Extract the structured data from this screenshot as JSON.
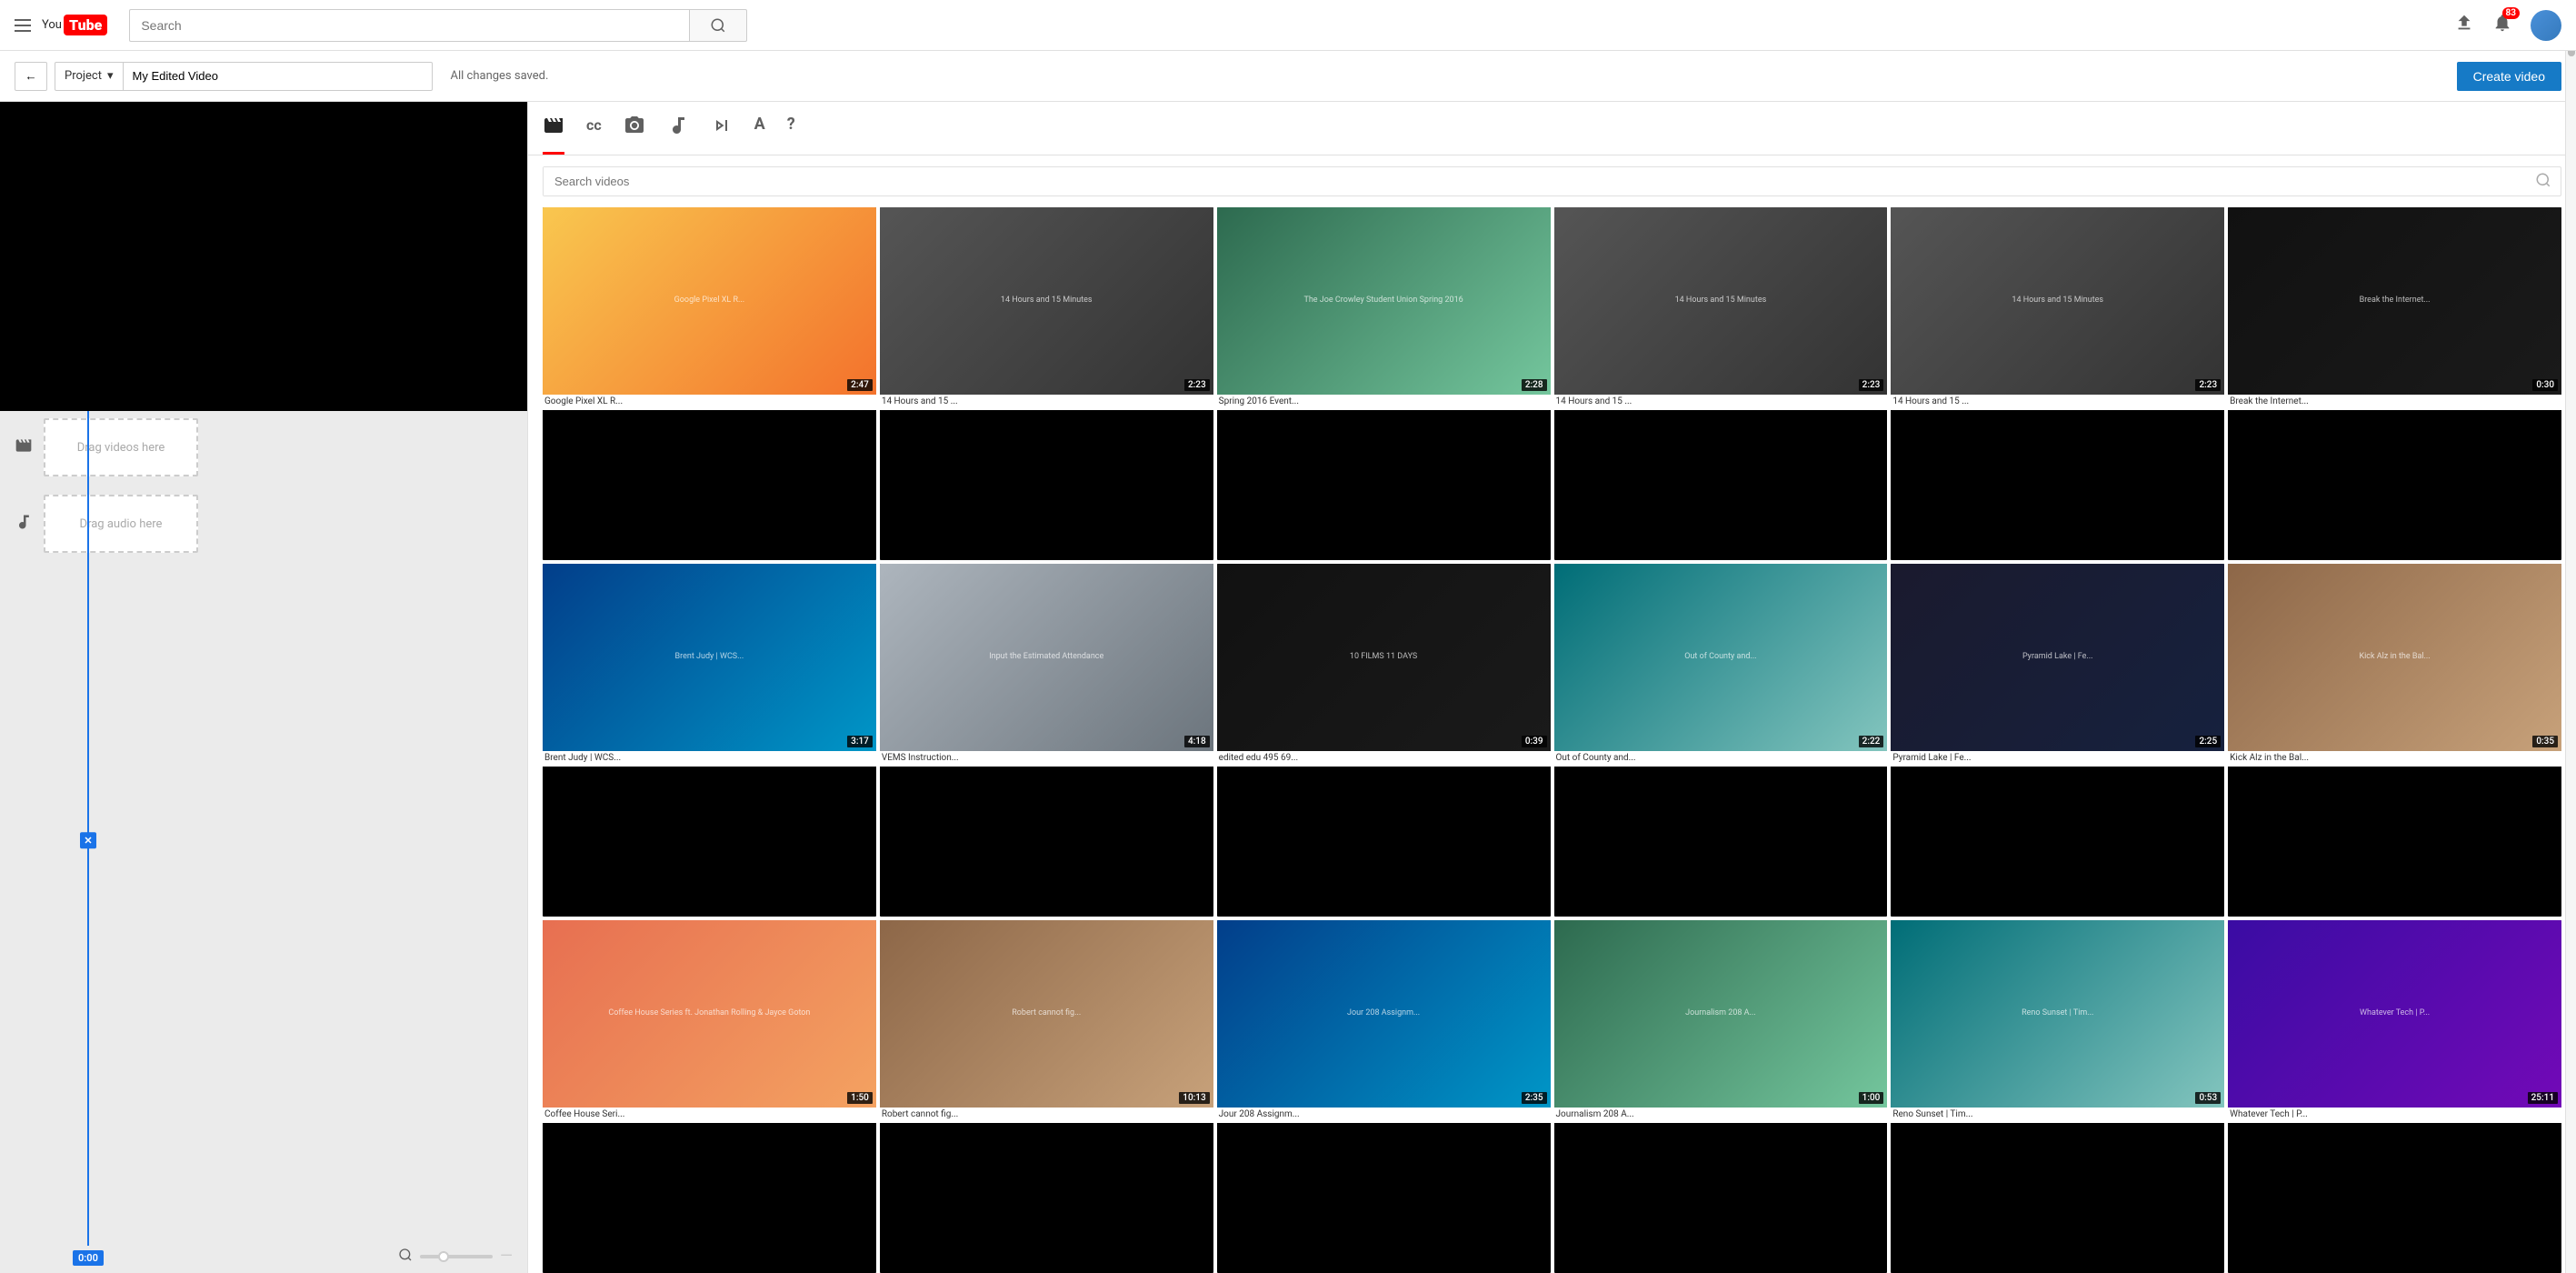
{
  "header": {
    "menu_label": "Menu",
    "logo_you": "You",
    "logo_tube": "Tube",
    "search_placeholder": "Search",
    "search_button_label": "Search",
    "upload_icon": "⬆",
    "notifications_icon": "🔔",
    "notification_count": "83",
    "avatar_label": "User avatar"
  },
  "toolbar": {
    "back_label": "←",
    "project_label": "Project",
    "project_dropdown_arrow": "▾",
    "project_name": "My Edited Video",
    "saved_status": "All changes saved.",
    "create_video_label": "Create video"
  },
  "panel": {
    "tabs": [
      {
        "id": "video",
        "icon": "🎥",
        "active": true
      },
      {
        "id": "cc",
        "icon": "©"
      },
      {
        "id": "photo",
        "icon": "📷"
      },
      {
        "id": "music",
        "icon": "♪"
      },
      {
        "id": "transitions",
        "icon": "⏭"
      },
      {
        "id": "text",
        "icon": "A"
      },
      {
        "id": "help",
        "icon": "?"
      }
    ],
    "search_placeholder": "Search videos",
    "videos": [
      {
        "title": "Google Pixel XL R...",
        "duration": "2:47",
        "color": "thumb-yellow"
      },
      {
        "title": "14 Hours and 15 ...",
        "duration": "2:23",
        "color": "thumb-gray",
        "label": "14 Hours and 15 Minutes"
      },
      {
        "title": "Spring 2016 Event...",
        "duration": "2:28",
        "color": "thumb-green",
        "label": "The Joe Crowley Student Union Spring 2016"
      },
      {
        "title": "14 Hours and 15 ...",
        "duration": "2:23",
        "color": "thumb-gray",
        "label": "14 Hours and 15 Minutes"
      },
      {
        "title": "14 Hours and 15 ...",
        "duration": "2:23",
        "color": "thumb-gray",
        "label": "14 Hours and 15 Minutes"
      },
      {
        "title": "Break the Internet...",
        "duration": "0:30",
        "color": "thumb-dark"
      },
      {
        "title": "Brent Judy | WCS...",
        "duration": "3:17",
        "color": "thumb-blue2"
      },
      {
        "title": "VEMS Instruction...",
        "duration": "4:18",
        "color": "thumb-light",
        "label": "Input the Estimated Attendance"
      },
      {
        "title": "edited edu 495 69...",
        "duration": "0:39",
        "color": "thumb-dark",
        "label": "10 FILMS 11 DAYS"
      },
      {
        "title": "Out of County and...",
        "duration": "2:22",
        "color": "thumb-teal"
      },
      {
        "title": "Pyramid Lake | Fe...",
        "duration": "2:25",
        "color": "thumb-blue"
      },
      {
        "title": "Kick Alz in the Bal...",
        "duration": "0:35",
        "color": "thumb-warm"
      },
      {
        "title": "Coffee House Seri...",
        "duration": "1:50",
        "color": "thumb-orange",
        "label": "Coffee House Series ft. Jonathan Rolling & Jayce Goton"
      },
      {
        "title": "Robert cannot fig...",
        "duration": "10:13",
        "color": "thumb-warm"
      },
      {
        "title": "Jour 208 Assignm...",
        "duration": "2:35",
        "color": "thumb-blue2"
      },
      {
        "title": "Journalism 208 A...",
        "duration": "1:00",
        "color": "thumb-green"
      },
      {
        "title": "Reno Sunset | Tim...",
        "duration": "0:53",
        "color": "thumb-teal"
      },
      {
        "title": "Whatever Tech | P...",
        "duration": "25:11",
        "color": "thumb-purple"
      }
    ]
  },
  "timeline": {
    "video_track_icon": "🎥",
    "audio_track_icon": "♪",
    "video_drop_label": "Drag videos here",
    "audio_drop_label": "Drag audio here",
    "scrubber_time": "0:00",
    "zoom_icon": "🔍"
  }
}
